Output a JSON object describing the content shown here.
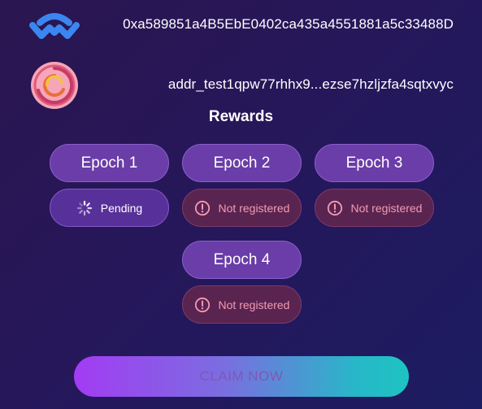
{
  "wallets": {
    "walletconnect": {
      "address": "0xa589851a4B5EbE0402ca435a4551881a5c33488D",
      "icon": "walletconnect-logo-icon"
    },
    "cardano": {
      "address": "addr_test1qpw77rhhx9...ezse7hzljzfa4sqtxvyc",
      "icon": "cardano-wallet-logo-icon"
    }
  },
  "rewards": {
    "title": "Rewards",
    "epochs": [
      {
        "label": "Epoch 1",
        "status": "Pending",
        "status_type": "pending"
      },
      {
        "label": "Epoch 2",
        "status": "Not registered",
        "status_type": "error"
      },
      {
        "label": "Epoch 3",
        "status": "Not registered",
        "status_type": "error"
      },
      {
        "label": "Epoch 4",
        "status": "Not registered",
        "status_type": "error"
      }
    ]
  },
  "claim": {
    "label": "CLAIM NOW"
  },
  "colors": {
    "background": "#26175a",
    "epoch_button": "#6a3da8",
    "pending_pill": "#58309a",
    "error_pill": "#5a2450",
    "error_text": "#f29bb4",
    "claim_gradient_start": "#a33bf3",
    "claim_gradient_end": "#1ec3c2"
  }
}
